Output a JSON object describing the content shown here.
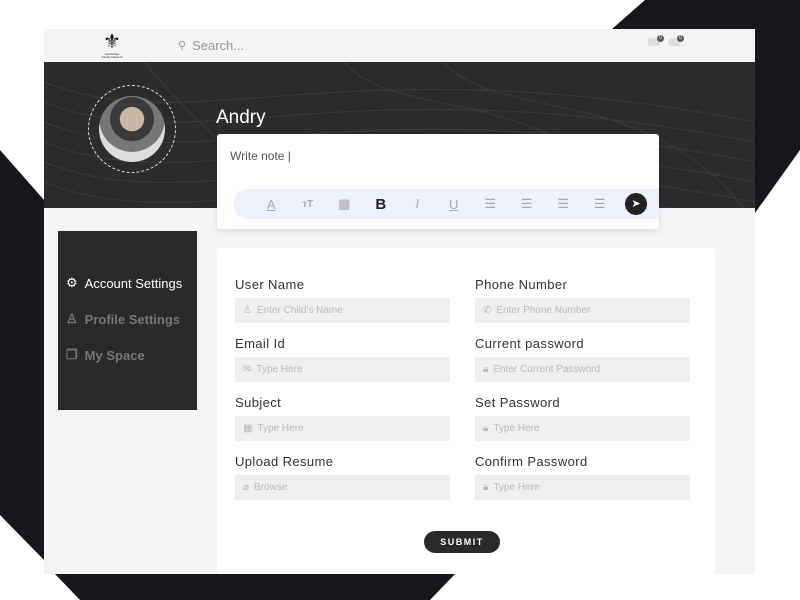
{
  "header": {
    "logo_text": "Cambridge Family Network",
    "search_placeholder": "Search...",
    "messages_count": "0",
    "notifications_count": "0"
  },
  "profile": {
    "name": "Andry",
    "note_placeholder": "Write note |"
  },
  "toolbar": {
    "tools": [
      "font-color",
      "text-size",
      "image",
      "bold",
      "italic",
      "underline",
      "justify",
      "align-left",
      "align-center",
      "align-right"
    ],
    "send": "send"
  },
  "sidebar": {
    "items": [
      {
        "label": "Account Settings",
        "icon": "gear-icon",
        "active": true
      },
      {
        "label": "Profile Settings",
        "icon": "user-icon"
      },
      {
        "label": "My Space",
        "icon": "copy-icon"
      }
    ]
  },
  "form": {
    "fields": [
      {
        "label": "User Name",
        "placeholder": "Enter Child's Name",
        "icon": "user-icon"
      },
      {
        "label": "Phone Number",
        "placeholder": "Enter Phone Number",
        "icon": "phone-icon"
      },
      {
        "label": "Email Id",
        "placeholder": "Type Here",
        "icon": "mail-icon"
      },
      {
        "label": "Current password",
        "placeholder": "Enter Current Password",
        "icon": "lock-icon"
      },
      {
        "label": "Subject",
        "placeholder": "Type Here",
        "icon": "calendar-icon"
      },
      {
        "label": "Set Password",
        "placeholder": "Type Here",
        "icon": "lock-icon"
      },
      {
        "label": "Upload Resume",
        "placeholder": "Browse",
        "icon": "paperclip-icon"
      },
      {
        "label": "Confirm Password",
        "placeholder": "Type Here",
        "icon": "lock-icon"
      }
    ],
    "submit": "SUBMIT"
  },
  "colors": {
    "dark": "#2a2a2c",
    "accent_bg": "#eff1fa"
  }
}
